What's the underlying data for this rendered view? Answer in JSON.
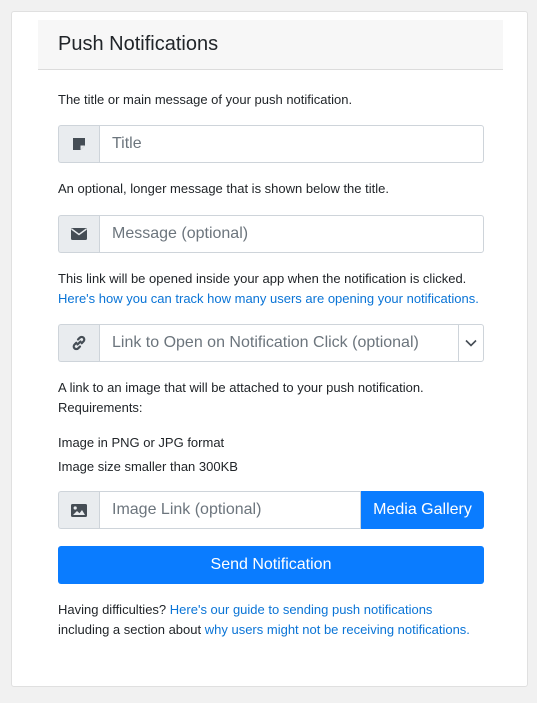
{
  "header": {
    "title": "Push Notifications"
  },
  "title_field": {
    "help": "The title or main message of your push notification.",
    "placeholder": "Title",
    "icon": "sticky-note-icon"
  },
  "message_field": {
    "help": "An optional, longer message that is shown below the title.",
    "placeholder": "Message (optional)",
    "icon": "envelope-icon"
  },
  "link_field": {
    "help": "This link will be opened inside your app when the notification is clicked.",
    "help_link": "Here's how you can track how many users are opening your notifications.",
    "placeholder": "Link to Open on Notification Click (optional)",
    "icon": "link-icon",
    "dropdown_icon": "chevron-down-icon"
  },
  "image_field": {
    "help_line1": "A link to an image that will be attached to your push notification.",
    "help_line2": "Requirements:",
    "requirement1": "Image in PNG or JPG format",
    "requirement2": "Image size smaller than 300KB",
    "placeholder": "Image Link (optional)",
    "icon": "image-icon",
    "gallery_label": "Media Gallery"
  },
  "send_button": {
    "label": "Send Notification"
  },
  "footer": {
    "text1": "Having difficulties?",
    "link1": "Here's our guide to sending push notifications",
    "text2": "including a section about",
    "link2": "why users might not be receiving notifications."
  },
  "colors": {
    "primary": "#0a7cff",
    "link": "#0a74d6",
    "addon_bg": "#e9ecef"
  }
}
